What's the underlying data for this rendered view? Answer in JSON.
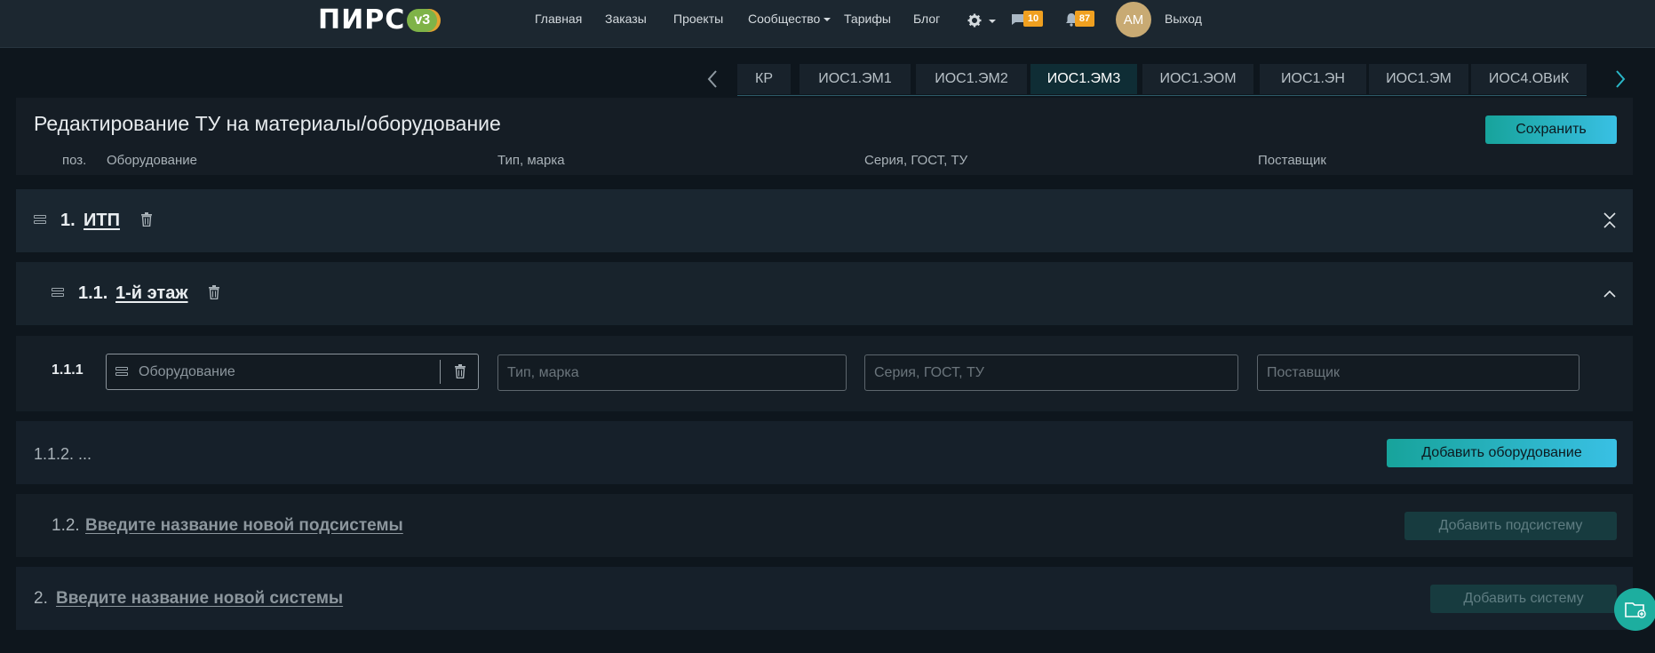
{
  "nav": {
    "logo_text": "ПИРС",
    "logo_version": "v3",
    "links": [
      "Главная",
      "Заказы",
      "Проекты",
      "Сообщество",
      "Тарифы",
      "Блог"
    ],
    "messages_count": "10",
    "notifications_count": "87",
    "avatar_initials": "АМ",
    "logout": "Выход"
  },
  "tabs": {
    "items": [
      "КР",
      "ИОС1.ЭМ1",
      "ИОС1.ЭМ2",
      "ИОС1.ЭМ3",
      "ИОС1.ЭОМ",
      "ИОС1.ЭН",
      "ИОС1.ЭМ",
      "ИОС4.ОВиК"
    ],
    "active": "ИОС1.ЭМ3"
  },
  "header": {
    "title": "Редактирование ТУ на материалы/оборудование",
    "save_label": "Сохранить",
    "columns": [
      "поз.",
      "Оборудование",
      "Тип, марка",
      "Серия, ГОСТ, ТУ",
      "Поставщик"
    ]
  },
  "system": {
    "number": "1.",
    "name": "ИТП"
  },
  "subsystem": {
    "number": "1.1.",
    "name": "1-й этаж"
  },
  "item": {
    "position": "1.1.1",
    "equipment_placeholder": "Оборудование",
    "type_placeholder": "Тип, марка",
    "series_placeholder": "Серия, ГОСТ, ТУ",
    "supplier_placeholder": "Поставщик"
  },
  "add_equipment": {
    "position": "1.1.2.",
    "ellipsis": "...",
    "button_label": "Добавить оборудование"
  },
  "new_subsystem": {
    "number": "1.2.",
    "placeholder": "Введите название новой подсистемы",
    "button_label": "Добавить подсистему"
  },
  "new_system": {
    "number": "2.",
    "placeholder": "Введите название новой системы",
    "button_label": "Добавить систему"
  },
  "colors": {
    "accent_start": "#17a39b",
    "accent_end": "#39c0e4",
    "badge": "#f0a020",
    "background": "#0e161d"
  }
}
